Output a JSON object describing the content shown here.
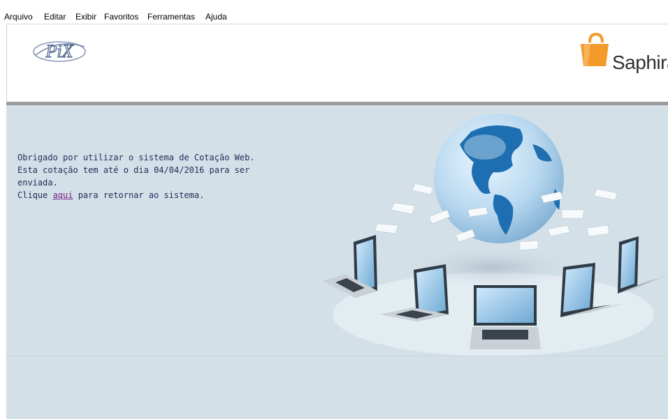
{
  "menu": {
    "items": [
      "Arquivo",
      "Editar",
      "Exibir",
      "Favoritos",
      "Ferramentas",
      "Ajuda"
    ]
  },
  "header": {
    "left_logo_text": "PiX",
    "right_logo_text": "Saphira",
    "brand_color": "#f39a2b"
  },
  "message": {
    "line1": "Obrigado por utilizar o sistema de Cotação Web.",
    "line2": "Esta cotação tem até o dia 04/04/2016 para ser enviada.",
    "line3_prefix": "Clique ",
    "line3_link": "aqui",
    "line3_suffix": " para retornar ao sistema."
  },
  "colors": {
    "background": "#d3e0e8",
    "text": "#1b2e55",
    "link": "#7a1f88",
    "header_bar": "#9a9a9a"
  }
}
